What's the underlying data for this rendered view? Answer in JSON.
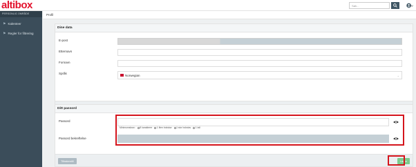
{
  "header": {
    "logo": "altibox",
    "search_placeholder": "Søk..."
  },
  "sidebar": {
    "title": "PERSONLIG OMRÅDE",
    "items": [
      {
        "label": "Kalenteer"
      },
      {
        "label": "Regler for filtrering"
      }
    ]
  },
  "breadcrumb": "Profil",
  "dine_data": {
    "title": "Dine data",
    "fields": [
      {
        "label": "E-post",
        "value": ""
      },
      {
        "label": "Etternavn",
        "value": ""
      },
      {
        "label": "Fornavn",
        "value": ""
      },
      {
        "label": "Språk",
        "value": "Norwegian"
      }
    ],
    "reset_label": "Tilbakestill",
    "save_label": "Lagre"
  },
  "passord": {
    "title": "Ditt passord",
    "password_label": "Passord",
    "confirm_label": "Passord bekreftelse",
    "hint_prefix": "Minimumskrav:",
    "hints": [
      "8 karakterer",
      "1 liten bokstav",
      "1 stor bokstav",
      "1 tall"
    ],
    "reset_label": "Tilbakestill",
    "save_label": "Lagre"
  },
  "colors": {
    "brand_red": "#e3122d",
    "sidebar_bg": "#3b4d5a",
    "save_green": "#7ccb8e",
    "highlight_red": "#d4141c"
  }
}
